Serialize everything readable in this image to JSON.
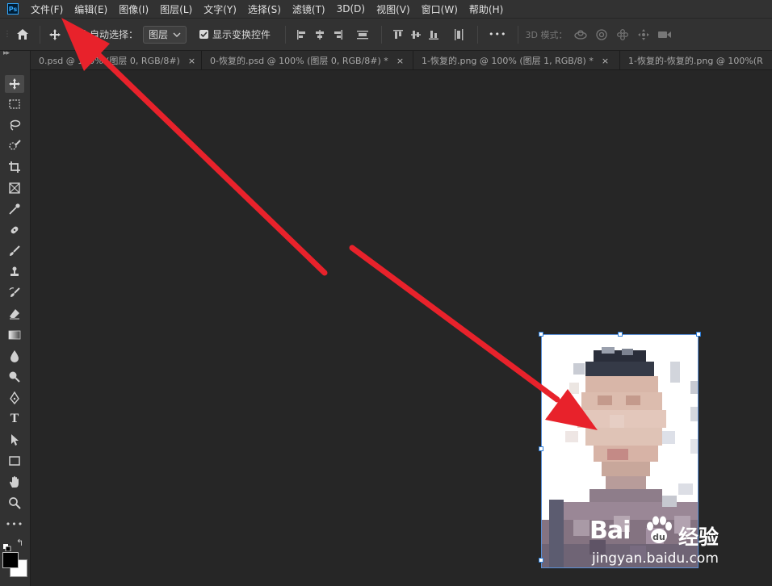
{
  "app": {
    "logo_text": "Ps"
  },
  "menu": [
    "文件(F)",
    "编辑(E)",
    "图像(I)",
    "图层(L)",
    "文字(Y)",
    "选择(S)",
    "滤镜(T)",
    "3D(D)",
    "视图(V)",
    "窗口(W)",
    "帮助(H)"
  ],
  "options": {
    "auto_select_label": "自动选择：",
    "auto_select_value": "图层",
    "show_transform_label": "显示变换控件",
    "more_label": "•••",
    "mode_3d_label": "3D 模式："
  },
  "tabs": [
    {
      "label": "0.psd @ 100% (图层 0, RGB/8#)",
      "close": "×"
    },
    {
      "label": "0-恢复的.psd @ 100% (图层 0, RGB/8#) *",
      "close": "×"
    },
    {
      "label": "1-恢复的.png @ 100% (图层 1, RGB/8) *",
      "close": "×"
    },
    {
      "label": "1-恢复的-恢复的.png @ 100%(R",
      "close": ""
    }
  ],
  "tools": [
    "move",
    "marquee",
    "lasso",
    "quick-select",
    "crop",
    "frame",
    "eyedropper",
    "healing",
    "brush",
    "stamp",
    "history-brush",
    "eraser",
    "gradient",
    "blur",
    "dodge",
    "pen",
    "type",
    "path-select",
    "rectangle",
    "hand",
    "zoom",
    "more"
  ],
  "toolbar": {
    "collapse": "▸▸",
    "more": "•••",
    "type_glyph": "T"
  },
  "colors": {
    "arrow": "#e8222b",
    "accent": "#31a8ff",
    "foreground": "#000000",
    "background": "#ffffff"
  },
  "watermark": {
    "brand": "Bai",
    "brand_end": "经验",
    "site": "jingyan.baidu.com"
  }
}
